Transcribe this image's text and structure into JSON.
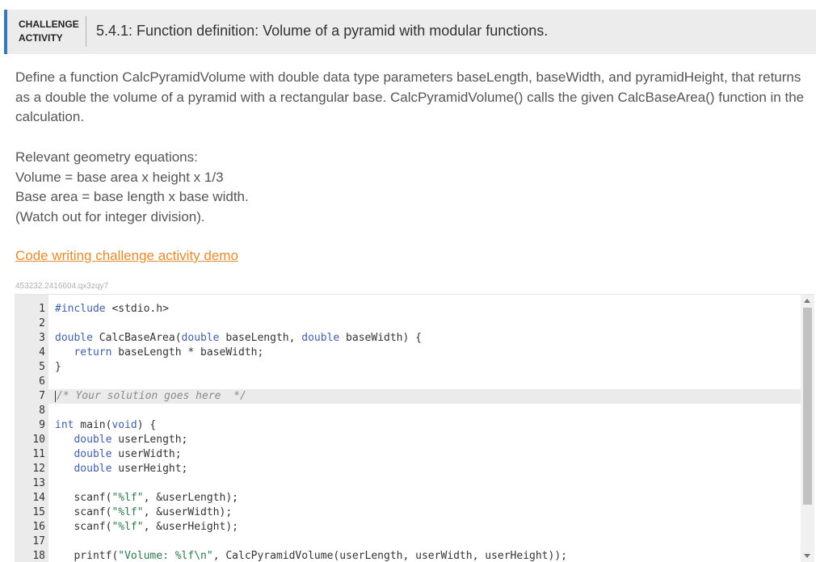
{
  "header": {
    "activity_label": "CHALLENGE ACTIVITY",
    "title": "5.4.1: Function definition: Volume of a pyramid with modular functions."
  },
  "description": "Define a function CalcPyramidVolume with double data type parameters baseLength, baseWidth, and pyramidHeight, that returns as a double the volume of a pyramid with a rectangular base. CalcPyramidVolume() calls the given CalcBaseArea() function in the calculation.",
  "equations": {
    "heading": "Relevant geometry equations:",
    "volume": "Volume = base area x height x 1/3",
    "base_area": "Base area = base length x base width.",
    "note": "(Watch out for integer division)."
  },
  "demo_link": "Code writing challenge activity demo",
  "code_id": "453232.2416604.qx3zqy7",
  "editor": {
    "line_numbers": [
      "1",
      "2",
      "3",
      "4",
      "5",
      "6",
      "7",
      "8",
      "9",
      "10",
      "11",
      "12",
      "13",
      "14",
      "15",
      "16",
      "17",
      "18"
    ],
    "active_line": 7,
    "accent": "#3b77b8",
    "link_color": "#e58b2f"
  }
}
